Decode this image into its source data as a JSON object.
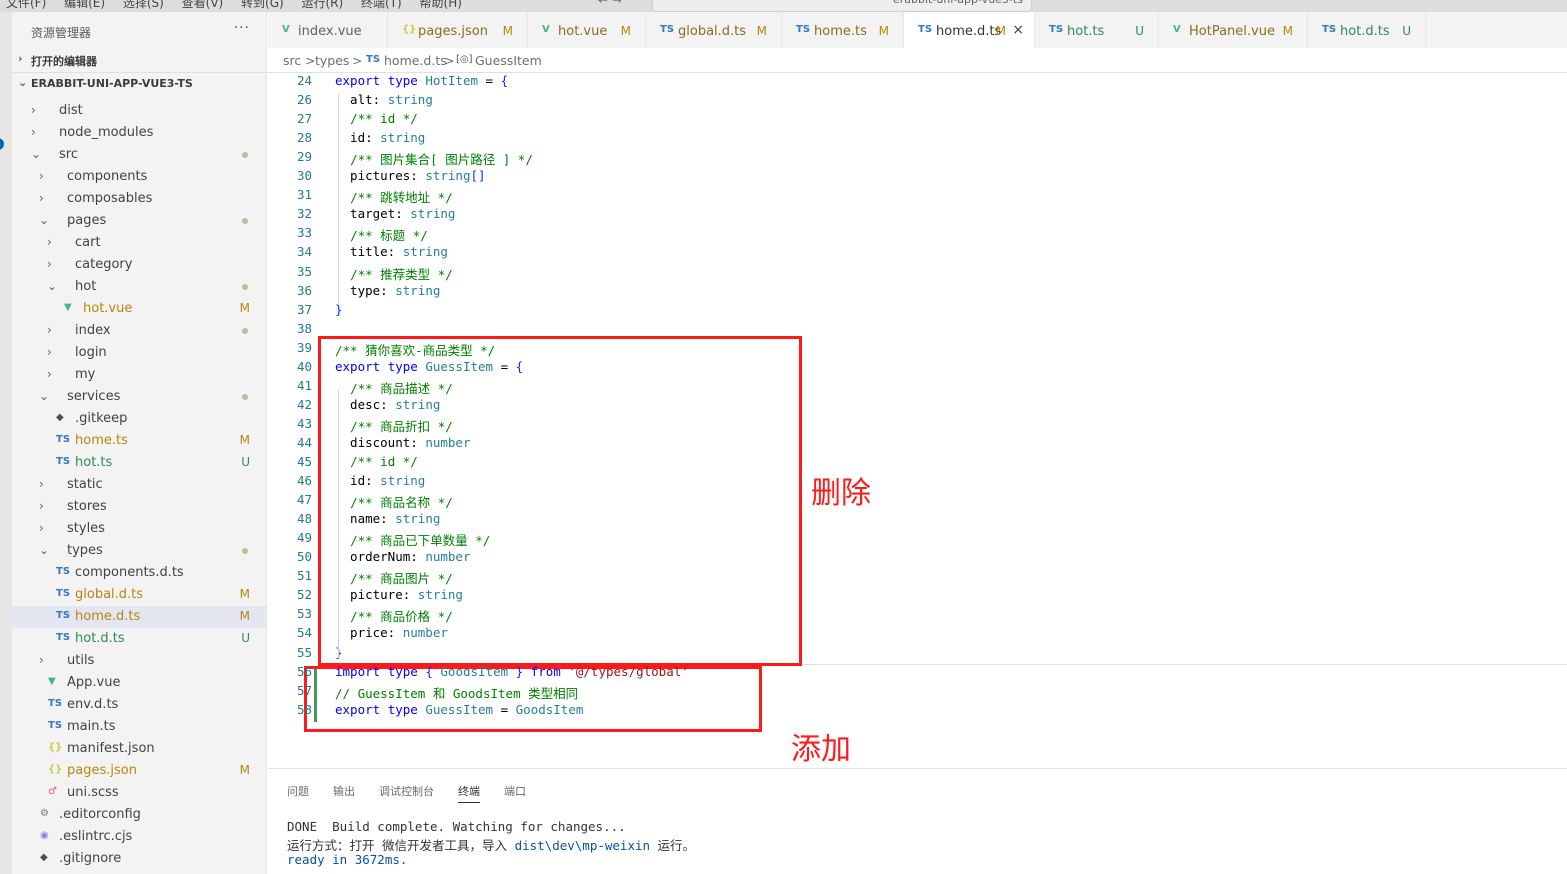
{
  "menubar": {
    "items": "文件(F)  编辑(E)  选择(S)  查看(V)  转到(G)  运行(R)  终端(T)  帮助(H)",
    "title": "erabbit-uni-app-vue3-ts",
    "nav": "← →"
  },
  "sidebar": {
    "header": "资源管理器",
    "more": "···",
    "open_editors": "打开的编辑器",
    "project": "ERABBIT-UNI-APP-VUE3-TS",
    "items": [
      {
        "label": "dist",
        "kind": "folder",
        "badge": ""
      },
      {
        "label": "node_modules",
        "kind": "folder",
        "badge": ""
      },
      {
        "label": "src",
        "kind": "folder-open",
        "badge": "●"
      },
      {
        "label": "components",
        "kind": "folder",
        "badge": ""
      },
      {
        "label": "composables",
        "kind": "folder",
        "badge": ""
      },
      {
        "label": "pages",
        "kind": "folder-open",
        "badge": "●"
      },
      {
        "label": "cart",
        "kind": "folder",
        "badge": ""
      },
      {
        "label": "category",
        "kind": "folder",
        "badge": ""
      },
      {
        "label": "hot",
        "kind": "folder-open",
        "badge": "●"
      },
      {
        "label": "hot.vue",
        "kind": "vue",
        "badge": "M"
      },
      {
        "label": "index",
        "kind": "folder",
        "badge": "●"
      },
      {
        "label": "login",
        "kind": "folder",
        "badge": ""
      },
      {
        "label": "my",
        "kind": "folder",
        "badge": ""
      },
      {
        "label": "services",
        "kind": "folder-open",
        "badge": "●"
      },
      {
        "label": ".gitkeep",
        "kind": "git",
        "badge": ""
      },
      {
        "label": "home.ts",
        "kind": "ts",
        "badge": "M"
      },
      {
        "label": "hot.ts",
        "kind": "ts",
        "badge": "U"
      },
      {
        "label": "static",
        "kind": "folder",
        "badge": ""
      },
      {
        "label": "stores",
        "kind": "folder",
        "badge": ""
      },
      {
        "label": "styles",
        "kind": "folder",
        "badge": ""
      },
      {
        "label": "types",
        "kind": "folder-open",
        "badge": "●"
      },
      {
        "label": "components.d.ts",
        "kind": "ts",
        "badge": ""
      },
      {
        "label": "global.d.ts",
        "kind": "ts",
        "badge": "M"
      },
      {
        "label": "home.d.ts",
        "kind": "ts",
        "badge": "M"
      },
      {
        "label": "hot.d.ts",
        "kind": "ts",
        "badge": "U"
      },
      {
        "label": "utils",
        "kind": "folder",
        "badge": ""
      },
      {
        "label": "App.vue",
        "kind": "vue",
        "badge": ""
      },
      {
        "label": "env.d.ts",
        "kind": "ts",
        "badge": ""
      },
      {
        "label": "main.ts",
        "kind": "ts",
        "badge": ""
      },
      {
        "label": "manifest.json",
        "kind": "json",
        "badge": ""
      },
      {
        "label": "pages.json",
        "kind": "json",
        "badge": "M"
      },
      {
        "label": "uni.scss",
        "kind": "scss",
        "badge": ""
      },
      {
        "label": ".editorconfig",
        "kind": "gear",
        "badge": ""
      },
      {
        "label": ".eslintrc.cjs",
        "kind": "eslint",
        "badge": ""
      },
      {
        "label": ".gitignore",
        "kind": "git",
        "badge": ""
      }
    ]
  },
  "tabs": [
    {
      "label": "index.vue",
      "icon": "V",
      "status": ""
    },
    {
      "label": "pages.json",
      "icon": "{}",
      "status": "M"
    },
    {
      "label": "hot.vue",
      "icon": "V",
      "status": "M"
    },
    {
      "label": "global.d.ts",
      "icon": "TS",
      "status": "M"
    },
    {
      "label": "home.ts",
      "icon": "TS",
      "status": "M"
    },
    {
      "label": "home.d.ts",
      "icon": "TS",
      "status": "M",
      "close": "×"
    },
    {
      "label": "hot.ts",
      "icon": "TS",
      "status": "U"
    },
    {
      "label": "HotPanel.vue",
      "icon": "V",
      "status": "M"
    },
    {
      "label": "hot.d.ts",
      "icon": "TS",
      "status": "U"
    }
  ],
  "breadcrumb": {
    "p1": "src",
    "sep": ">",
    "p2": "types",
    "p3_icon": "TS",
    "p3": "home.d.ts",
    "p4_icon": "[◎]",
    "p4": "GuessItem"
  },
  "editor": {
    "lines": [
      {
        "n": "24",
        "html": "<span class='kw'>export</span> <span class='kw'>type</span> <span class='ty'>HotItem</span> = <span class='br'>{</span>"
      },
      {
        "n": "26",
        "html": "  alt: <span class='ty'>string</span>"
      },
      {
        "n": "27",
        "html": "  <span class='cm'>/** id */</span>"
      },
      {
        "n": "28",
        "html": "  id: <span class='ty'>string</span>"
      },
      {
        "n": "29",
        "html": "  <span class='cm'>/** 图片集合[ 图片路径 ] */</span>"
      },
      {
        "n": "30",
        "html": "  pictures: <span class='ty'>string</span><span class='br'>[]</span>"
      },
      {
        "n": "31",
        "html": "  <span class='cm'>/** 跳转地址 */</span>"
      },
      {
        "n": "32",
        "html": "  target: <span class='ty'>string</span>"
      },
      {
        "n": "33",
        "html": "  <span class='cm'>/** 标题 */</span>"
      },
      {
        "n": "34",
        "html": "  title: <span class='ty'>string</span>"
      },
      {
        "n": "35",
        "html": "  <span class='cm'>/** 推荐类型 */</span>"
      },
      {
        "n": "36",
        "html": "  type: <span class='ty'>string</span>"
      },
      {
        "n": "37",
        "html": "<span class='br'>}</span>"
      },
      {
        "n": "38",
        "html": ""
      },
      {
        "n": "39",
        "html": "<span class='cm'>/** 猜你喜欢-商品类型 */</span>"
      },
      {
        "n": "40",
        "html": "<span class='kw'>export</span> <span class='kw'>type</span> <span class='ty'>GuessItem</span> = <span class='br'>{</span>"
      },
      {
        "n": "41",
        "html": "  <span class='cm'>/** 商品描述 */</span>"
      },
      {
        "n": "42",
        "html": "  desc: <span class='ty'>string</span>"
      },
      {
        "n": "43",
        "html": "  <span class='cm'>/** 商品折扣 */</span>"
      },
      {
        "n": "44",
        "html": "  discount: <span class='ty'>number</span>"
      },
      {
        "n": "45",
        "html": "  <span class='cm'>/** id */</span>"
      },
      {
        "n": "46",
        "html": "  id: <span class='ty'>string</span>"
      },
      {
        "n": "47",
        "html": "  <span class='cm'>/** 商品名称 */</span>"
      },
      {
        "n": "48",
        "html": "  name: <span class='ty'>string</span>"
      },
      {
        "n": "49",
        "html": "  <span class='cm'>/** 商品已下单数量 */</span>"
      },
      {
        "n": "50",
        "html": "  orderNum: <span class='ty'>number</span>"
      },
      {
        "n": "51",
        "html": "  <span class='cm'>/** 商品图片 */</span>"
      },
      {
        "n": "52",
        "html": "  picture: <span class='ty'>string</span>"
      },
      {
        "n": "53",
        "html": "  <span class='cm'>/** 商品价格 */</span>"
      },
      {
        "n": "54",
        "html": "  price: <span class='ty'>number</span>"
      },
      {
        "n": "55",
        "html": "<span class='br'>}</span>"
      },
      {
        "n": "56",
        "html": "<span class='kw'>import</span> <span class='kw'>type</span> <span class='br'>{</span> <span class='ty'>GoodsItem</span> <span class='br'>}</span> <span class='kw'>from</span> <span class='str'>'@/types/global'</span>"
      },
      {
        "n": "57",
        "html": "<span class='cm'>// GuessItem 和 GoodsItem 类型相同</span>"
      },
      {
        "n": "58",
        "html": "<span class='kw'>export</span> <span class='kw'>type</span> <span class='ty'>GuessItem</span> = <span class='ty'>GoodsItem</span>"
      }
    ],
    "annotation_delete": "删除",
    "annotation_add": "添加"
  },
  "panel": {
    "tabs": [
      "问题",
      "输出",
      "调试控制台",
      "终端",
      "端口"
    ],
    "active_tab": "终端",
    "terminal": [
      "DONE  Build complete. Watching for changes...",
      "运行方式：打开 微信开发者工具，导入 dist\\dev\\mp-weixin 运行。",
      "ready in 3672ms."
    ]
  },
  "colors": {
    "accent": "#0069b4",
    "annotation": "#ff1a1a",
    "git_added": "#48985d",
    "modified": "#b8860b",
    "untracked": "#2e8b57"
  }
}
